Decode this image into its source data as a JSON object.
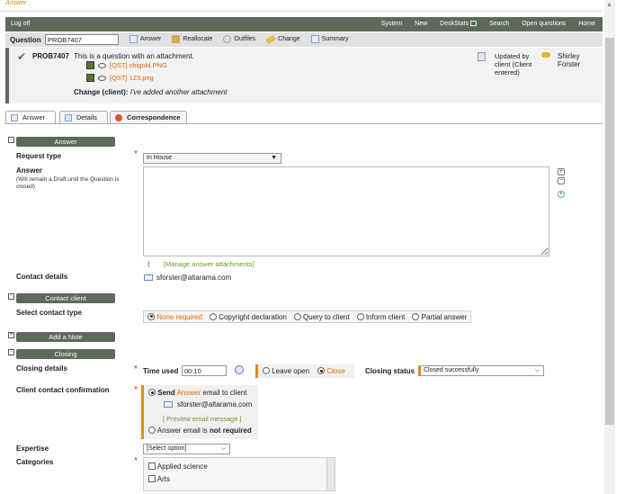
{
  "page": {
    "heading": "Answer"
  },
  "nav": {
    "logoff": "Log off",
    "items": [
      "System",
      "New",
      "DeskStats",
      "Search",
      "Open questions",
      "Home"
    ]
  },
  "question_bar": {
    "label": "Question",
    "id_value": "PROB7407",
    "actions": [
      "Answer",
      "Reallocate",
      "Outfiles",
      "Change",
      "Summary"
    ]
  },
  "question": {
    "id": "PROB7407",
    "text": "This is a question with an attachment.",
    "attachments": [
      "[QST] chigold.PNG",
      "[QST] 123.png"
    ],
    "change_label": "Change (client):",
    "change_text": "I've added another attachment",
    "updated_by": "Updated by client (Client entered)",
    "user": "Shirley Forster"
  },
  "tabs": [
    "Answer",
    "Details",
    "Correspondence"
  ],
  "answer_section": {
    "header": "Answer",
    "request_type_label": "Request type",
    "request_type_value": "In House",
    "answer_label": "Answer",
    "answer_note": "(Will remain a Draft until the Question is closed)",
    "manage_attachments": "[Manage answer attachments]",
    "contact_details_label": "Contact details",
    "contact_email": "sforster@altarama.com"
  },
  "contact_section": {
    "header": "Contact client",
    "select_label": "Select contact type",
    "options": [
      "None required",
      "Copyright declaration",
      "Query to client",
      "Inform client",
      "Partial answer"
    ],
    "selected": "None required"
  },
  "note_section": {
    "header": "Add a Note"
  },
  "closing_section": {
    "header": "Closing",
    "details_label": "Closing details",
    "time_used_label": "Time used",
    "time_used_value": "00:10",
    "leave_open": "Leave open",
    "close": "Close",
    "status_label": "Closing status",
    "status_value": "Closed successfully",
    "confirmation_label": "Client contact confirmation",
    "send_prefix": "Send",
    "send_word": "Answer",
    "send_suffix": "email to client",
    "send_email": "sforster@altarama.com",
    "preview": "[ Preview email message ]",
    "not_required_prefix": "Answer email is",
    "not_required_bold": "not required",
    "expertise_label": "Expertise",
    "expertise_value": "[Select option]",
    "categories_label": "Categories",
    "categories": [
      "Applied science",
      "Arts"
    ]
  },
  "colors": {
    "nav_bg": "#5d6a5a",
    "accent": "#e06a00",
    "link_green": "#6a9a1e"
  }
}
